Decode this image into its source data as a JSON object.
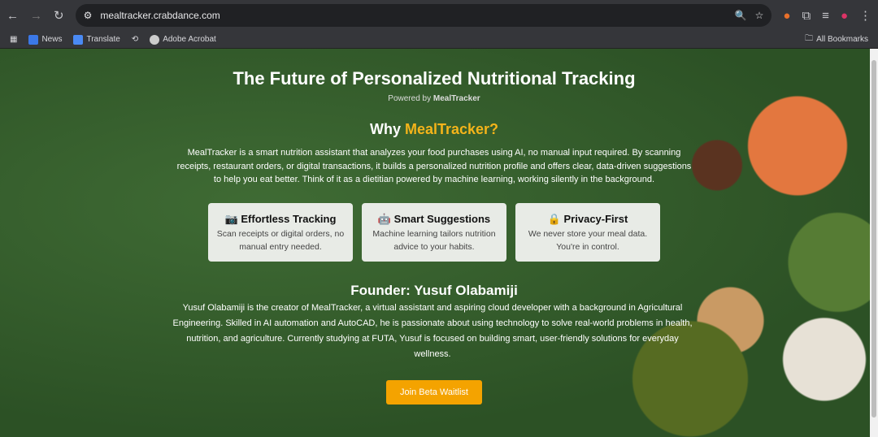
{
  "browser": {
    "url": "mealtracker.crabdance.com",
    "bookmarks": [
      "News",
      "Translate",
      "Adobe Acrobat"
    ],
    "all_bookmarks": "All Bookmarks"
  },
  "hero": {
    "title": "The Future of Personalized Nutritional Tracking",
    "powered_prefix": "Powered by ",
    "powered_brand": "MealTracker"
  },
  "why": {
    "prefix": "Why ",
    "brand": "MealTracker?",
    "body": "MealTracker is a smart nutrition assistant that analyzes your food purchases using AI, no manual input required. By scanning receipts, restaurant orders, or digital transactions, it builds a personalized nutrition profile and offers clear, data-driven suggestions to help you eat better. Think of it as a dietitian powered by machine learning, working silently in the background."
  },
  "features": [
    {
      "icon": "📷",
      "title": "Effortless Tracking",
      "desc": "Scan receipts or digital orders, no manual entry needed."
    },
    {
      "icon": "🤖",
      "title": "Smart Suggestions",
      "desc": "Machine learning tailors nutrition advice to your habits."
    },
    {
      "icon": "🔒",
      "title": "Privacy-First",
      "desc": "We never store your meal data. You're in control."
    }
  ],
  "founder": {
    "title": "Founder: Yusuf Olabamiji",
    "bio": "Yusuf Olabamiji is the creator of MealTracker, a virtual assistant and aspiring cloud developer with a background in Agricultural Engineering. Skilled in AI automation and AutoCAD, he is passionate about using technology to solve real-world problems in health, nutrition, and agriculture. Currently studying at FUTA, Yusuf is focused on building smart, user-friendly solutions for everyday wellness."
  },
  "cta": "Join Beta Waitlist"
}
